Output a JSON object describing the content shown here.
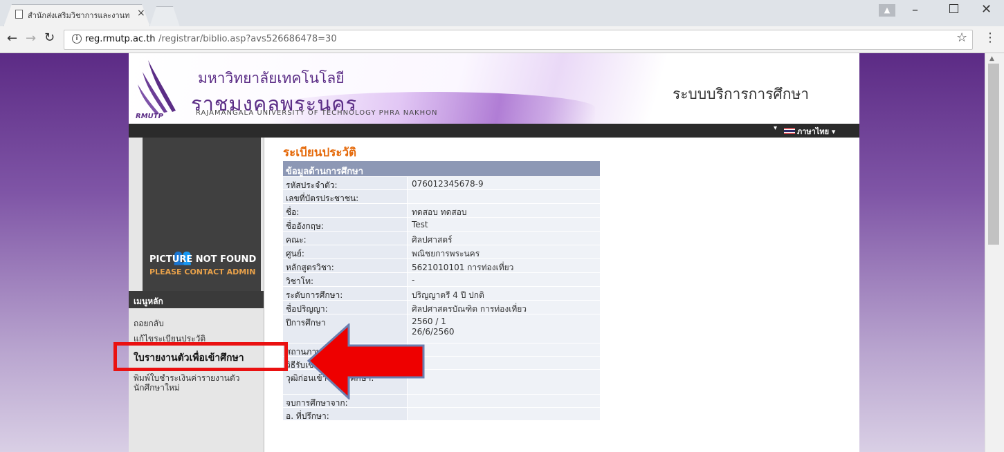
{
  "browser": {
    "tab_title": "สำนักส่งเสริมวิชาการและงานท",
    "url_host": "reg.rmutp.ac.th",
    "url_path": "/registrar/biblio.asp?avs526686478=30"
  },
  "header": {
    "logo_text": "RMUTP",
    "uni_thai_1": "มหาวิทยาลัยเทคโนโลยี",
    "uni_thai_2": "ราชมงคลพระนคร",
    "uni_eng": "RAJAMANGALA UNIVERSITY  OF TECHNOLOGY PHRA NAKHON",
    "system_title": "ระบบบริการการศึกษา",
    "language": "ภาษาไทย"
  },
  "sidebar": {
    "picture_line1": "PICTURE NOT FOUND",
    "picture_line2": "PLEASE CONTACT ADMIN",
    "menu_header": "เมนูหลัก",
    "items": [
      {
        "label": "ถอยกลับ"
      },
      {
        "label": "แก้ไขระเบียนประวัติ"
      },
      {
        "label": "ใบรายงานตัวเพื่อเข้าศึกษา"
      },
      {
        "label": "พิมพ์ใบชำระเงินค่ารายงานตัว นักศึกษาใหม่"
      }
    ]
  },
  "main": {
    "heading": "ระเบียนประวัติ",
    "section_title": "ข้อมูลด้านการศึกษา",
    "rows": [
      {
        "label": "รหัสประจำตัว:",
        "value": "076012345678-9"
      },
      {
        "label": "เลขที่บัตรประชาชน:",
        "value": ""
      },
      {
        "label": "ชื่อ:",
        "value": "ทดสอบ  ทดสอบ"
      },
      {
        "label": "ชื่ออังกฤษ:",
        "value": "Test"
      },
      {
        "label": "คณะ:",
        "value": "ศิลปศาสตร์"
      },
      {
        "label": "ศูนย์:",
        "value": "พณิชยการพระนคร"
      },
      {
        "label": "หลักสูตรวิชา:",
        "value": "5621010101 การท่องเที่ยว"
      },
      {
        "label": "วิชาโท:",
        "value": "-"
      },
      {
        "label": "ระดับการศึกษา:",
        "value": "ปริญญาตรี 4 ปี ปกติ"
      },
      {
        "label": "ชื่อปริญญา:",
        "value": "ศิลปศาสตรบัณฑิต การท่องเที่ยว"
      },
      {
        "label": "ปีการศึกษา",
        "value": "2560 / 1",
        "value2": "26/6/2560"
      },
      {
        "label": "สถานภาพ:",
        "value": ""
      },
      {
        "label": "วิธีรับเข้า:",
        "value": ""
      },
      {
        "label": "วุฒิก่อนเข้ารับการศึกษา:",
        "value": ""
      },
      {
        "label": "จบการศึกษาจาก:",
        "value": ""
      },
      {
        "label": "อ. ที่ปรึกษา:",
        "value": ""
      }
    ]
  },
  "colors": {
    "heading": "#e56a0b",
    "table_header": "#8d98b5",
    "highlight": "#ea1111"
  }
}
